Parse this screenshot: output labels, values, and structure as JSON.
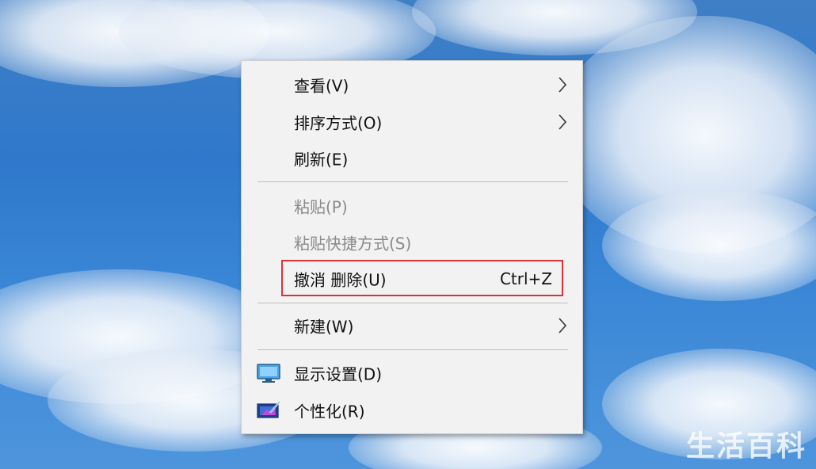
{
  "context_menu": {
    "items": [
      {
        "label": "查看(V)",
        "submenu": true
      },
      {
        "label": "排序方式(O)",
        "submenu": true
      },
      {
        "label": "刷新(E)"
      },
      {
        "label": "粘贴(P)",
        "disabled": true
      },
      {
        "label": "粘贴快捷方式(S)",
        "disabled": true
      },
      {
        "label": "撤消 删除(U)",
        "shortcut": "Ctrl+Z",
        "highlighted": true
      },
      {
        "label": "新建(W)",
        "submenu": true
      },
      {
        "label": "显示设置(D)",
        "icon": "display-settings-icon"
      },
      {
        "label": "个性化(R)",
        "icon": "personalize-icon"
      }
    ]
  },
  "watermark": "生活百科",
  "colors": {
    "highlight_border": "#d6343b",
    "menu_background": "#f2f2f2",
    "disabled_text": "#8a8a8a"
  }
}
